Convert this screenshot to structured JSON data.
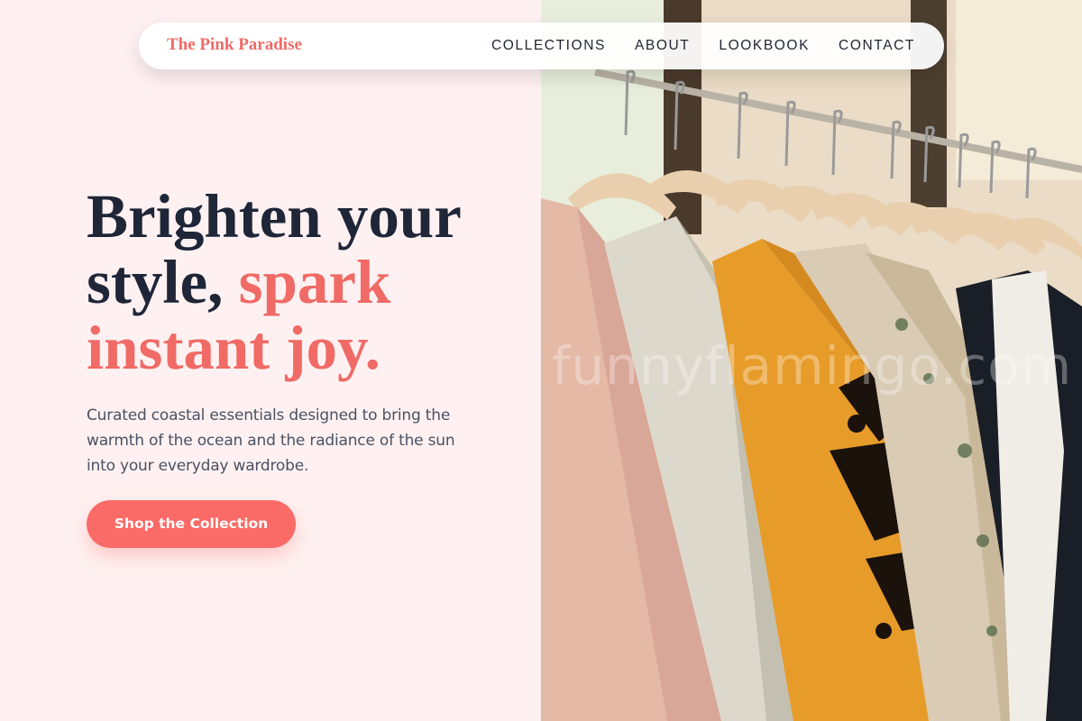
{
  "brand": {
    "name": "The Pink Paradise"
  },
  "nav": {
    "links": [
      "COLLECTIONS",
      "ABOUT",
      "LOOKBOOK",
      "CONTACT"
    ]
  },
  "hero": {
    "headline_part1": "Brighten your style,",
    "headline_accent": "spark instant joy.",
    "subtext": "Curated coastal essentials designed to bring the warmth of the ocean and the radiance of the sun into your everyday wardrobe.",
    "cta_label": "Shop the Collection"
  },
  "image": {
    "watermark": "funnyflamingo.com"
  },
  "colors": {
    "background": "#fff1f1",
    "accent": "#f06a66",
    "button": "#fa6a66",
    "heading": "#1e2638",
    "body_text": "#4a5163"
  }
}
